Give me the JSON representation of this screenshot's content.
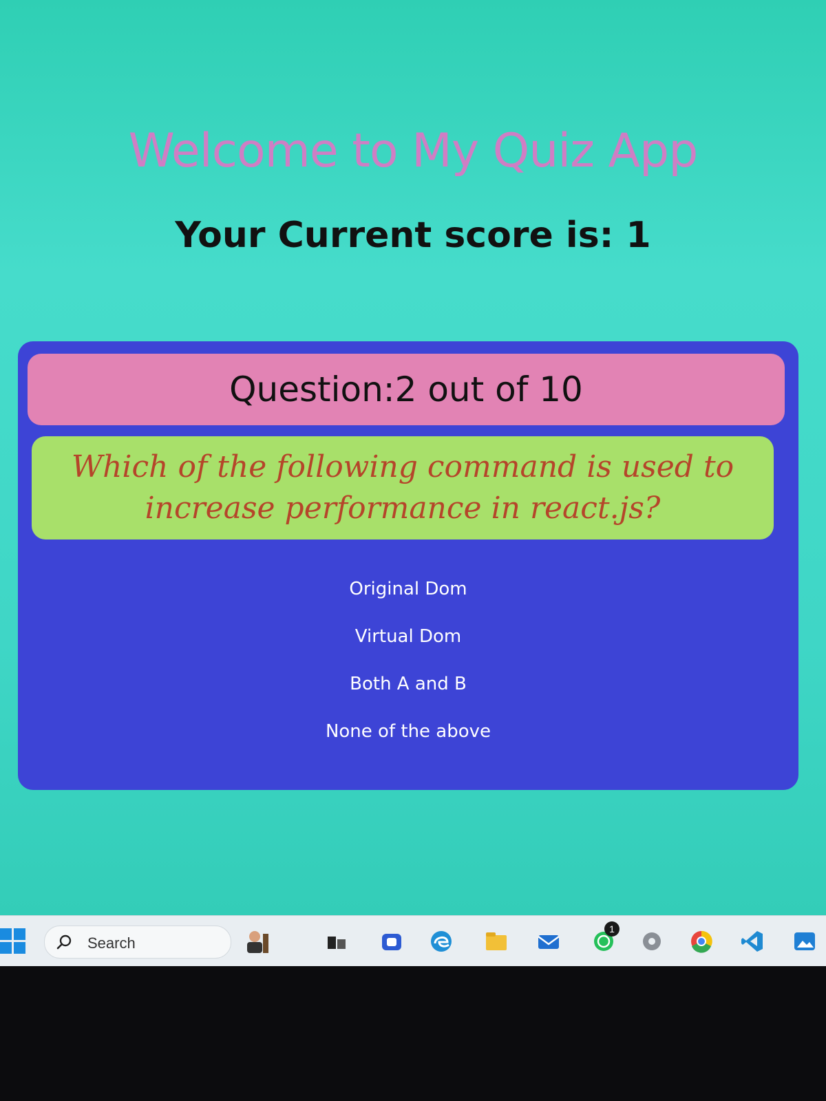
{
  "app": {
    "title": "Welcome to My Quiz App",
    "score_text": "Your Current score is: 1"
  },
  "quiz": {
    "counter": "Question:2 out of 10",
    "question": "Which of the following command is used to increase performance in react.js?",
    "options": [
      "Original Dom",
      "Virtual Dom",
      "Both A and B",
      "None of the above"
    ]
  },
  "taskbar": {
    "search_label": "Search",
    "notification_count": "1",
    "icons": [
      "windows-start-icon",
      "search-icon",
      "user-avatar-icon",
      "task-view-icon",
      "teams-icon",
      "edge-icon",
      "file-explorer-icon",
      "mail-icon",
      "whatsapp-icon",
      "settings-icon",
      "chrome-icon",
      "vscode-icon",
      "photos-icon"
    ]
  },
  "colors": {
    "background": "#3fd6c6",
    "title": "#cf7ec4",
    "card": "#3d44d6",
    "counter_bg": "#e283b4",
    "question_bg": "#a8e06a",
    "question_text": "#b5452a"
  }
}
